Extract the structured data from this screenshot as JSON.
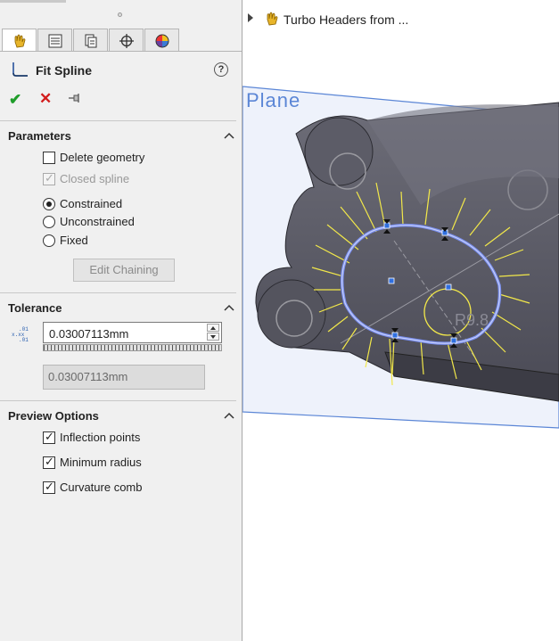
{
  "panel": {
    "title": "Fit Spline",
    "help": "?",
    "actions": {
      "ok": "✔",
      "cancel": "✕"
    },
    "parameters": {
      "header": "Parameters",
      "delete_geometry": {
        "label": "Delete geometry",
        "checked": false
      },
      "closed_spline": {
        "label": "Closed spline",
        "checked": true,
        "disabled": true
      },
      "constraint_options": [
        {
          "label": "Constrained",
          "selected": true
        },
        {
          "label": "Unconstrained",
          "selected": false
        },
        {
          "label": "Fixed",
          "selected": false
        }
      ],
      "edit_chaining_label": "Edit Chaining"
    },
    "tolerance": {
      "header": "Tolerance",
      "value": "0.03007113mm",
      "readout": "0.03007113mm"
    },
    "preview_options": {
      "header": "Preview Options",
      "items": [
        {
          "label": "Inflection points",
          "checked": true
        },
        {
          "label": "Minimum radius",
          "checked": true
        },
        {
          "label": "Curvature comb",
          "checked": true
        }
      ]
    }
  },
  "viewport": {
    "tree_item": "Turbo Headers from ...",
    "plane_label": "Plane",
    "dimension_label": "R9.8"
  },
  "colors": {
    "accent_blue": "#5b86d6",
    "comb_yellow": "#f2e84a",
    "part_gray": "#5a5a66"
  }
}
